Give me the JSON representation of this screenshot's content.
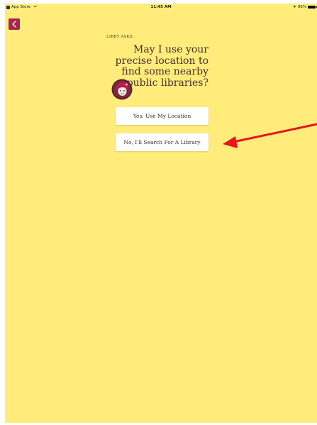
{
  "status_bar": {
    "carrier": "App Store",
    "time": "11:45 AM",
    "battery": "96%"
  },
  "prompt": {
    "asks_label": "LIBBY ASKS:",
    "question": "May I use your\nprecise location to\nfind some nearby\npublic libraries?"
  },
  "buttons": {
    "yes_label": "Yes, Use My Location",
    "no_label": "No, I'll Search For A Library"
  },
  "colors": {
    "background": "#FFEC7A",
    "brand": "#A8264E",
    "annotation_arrow": "#E8141B"
  },
  "icons": {
    "back": "chevron-left-icon",
    "avatar": "libby-avatar-icon"
  }
}
